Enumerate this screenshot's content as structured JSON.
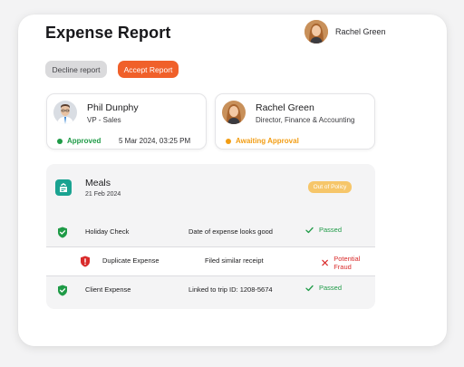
{
  "header": {
    "title": "Expense Report"
  },
  "user": {
    "name": "Rachel Green"
  },
  "actions": {
    "decline_label": "Decline report",
    "accept_label": "Accept Report"
  },
  "approvers": [
    {
      "name": "Phil Dunphy",
      "role": "VP - Sales",
      "status": "Approved",
      "date": "5 Mar 2024, 03:25 PM",
      "status_color": "#1f9b47"
    },
    {
      "name": "Rachel Green",
      "role": "Director, Finance & Accounting",
      "status": "Awaiting Approval",
      "date": "",
      "status_color": "#f29d14"
    }
  ],
  "expense": {
    "category": "Meals",
    "date": "21 Feb 2024",
    "badge": "Out of Policy",
    "checks": [
      {
        "name": "Holiday Check",
        "detail": "Date of expense looks good",
        "result": "Passed",
        "result_color": "#1f9b47",
        "icon": "shield-check-icon"
      },
      {
        "name": "Duplicate Expense",
        "detail": "Filed similar receipt",
        "result": "Potential Fraud",
        "result_color": "#d92b2b",
        "icon": "shield-alert-icon"
      },
      {
        "name": "Client Expense",
        "detail": "Linked to trip ID: 1208-5674",
        "result": "Passed",
        "result_color": "#1f9b47",
        "icon": "shield-check-icon"
      }
    ]
  },
  "colors": {
    "accent": "#f0602a",
    "teal": "#1aa391",
    "badge": "#f6c66a"
  }
}
